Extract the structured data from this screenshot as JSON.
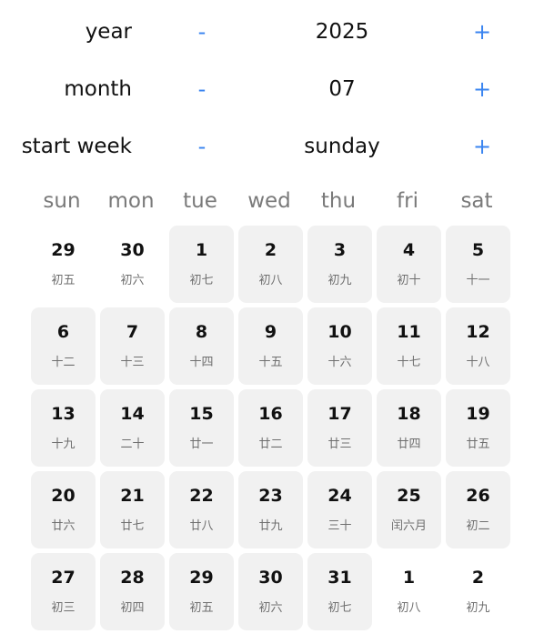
{
  "controls": {
    "year": {
      "label": "year",
      "minus": "-",
      "value": "2025",
      "plus": "+"
    },
    "month": {
      "label": "month",
      "minus": "-",
      "value": "07",
      "plus": "+"
    },
    "start_week": {
      "label": "start week",
      "minus": "-",
      "value": "sunday",
      "plus": "+"
    }
  },
  "weekdays": [
    "sun",
    "mon",
    "tue",
    "wed",
    "thu",
    "fri",
    "sat"
  ],
  "weeks": [
    [
      {
        "day": "29",
        "lunar": "初五",
        "current_month": false
      },
      {
        "day": "30",
        "lunar": "初六",
        "current_month": false
      },
      {
        "day": "1",
        "lunar": "初七",
        "current_month": true
      },
      {
        "day": "2",
        "lunar": "初八",
        "current_month": true
      },
      {
        "day": "3",
        "lunar": "初九",
        "current_month": true
      },
      {
        "day": "4",
        "lunar": "初十",
        "current_month": true
      },
      {
        "day": "5",
        "lunar": "十一",
        "current_month": true
      }
    ],
    [
      {
        "day": "6",
        "lunar": "十二",
        "current_month": true
      },
      {
        "day": "7",
        "lunar": "十三",
        "current_month": true
      },
      {
        "day": "8",
        "lunar": "十四",
        "current_month": true
      },
      {
        "day": "9",
        "lunar": "十五",
        "current_month": true
      },
      {
        "day": "10",
        "lunar": "十六",
        "current_month": true
      },
      {
        "day": "11",
        "lunar": "十七",
        "current_month": true
      },
      {
        "day": "12",
        "lunar": "十八",
        "current_month": true
      }
    ],
    [
      {
        "day": "13",
        "lunar": "十九",
        "current_month": true
      },
      {
        "day": "14",
        "lunar": "二十",
        "current_month": true
      },
      {
        "day": "15",
        "lunar": "廿一",
        "current_month": true
      },
      {
        "day": "16",
        "lunar": "廿二",
        "current_month": true
      },
      {
        "day": "17",
        "lunar": "廿三",
        "current_month": true
      },
      {
        "day": "18",
        "lunar": "廿四",
        "current_month": true
      },
      {
        "day": "19",
        "lunar": "廿五",
        "current_month": true
      }
    ],
    [
      {
        "day": "20",
        "lunar": "廿六",
        "current_month": true
      },
      {
        "day": "21",
        "lunar": "廿七",
        "current_month": true
      },
      {
        "day": "22",
        "lunar": "廿八",
        "current_month": true
      },
      {
        "day": "23",
        "lunar": "廿九",
        "current_month": true
      },
      {
        "day": "24",
        "lunar": "三十",
        "current_month": true
      },
      {
        "day": "25",
        "lunar": "闰六月",
        "current_month": true
      },
      {
        "day": "26",
        "lunar": "初二",
        "current_month": true
      }
    ],
    [
      {
        "day": "27",
        "lunar": "初三",
        "current_month": true
      },
      {
        "day": "28",
        "lunar": "初四",
        "current_month": true
      },
      {
        "day": "29",
        "lunar": "初五",
        "current_month": true
      },
      {
        "day": "30",
        "lunar": "初六",
        "current_month": true
      },
      {
        "day": "31",
        "lunar": "初七",
        "current_month": true
      },
      {
        "day": "1",
        "lunar": "初八",
        "current_month": false
      },
      {
        "day": "2",
        "lunar": "初九",
        "current_month": false
      }
    ]
  ],
  "colors": {
    "accent": "#3a84f0",
    "cell_background": "#f1f1f1",
    "weekday_text": "#7a7a7a",
    "lunar_text": "#6f6f6f"
  }
}
